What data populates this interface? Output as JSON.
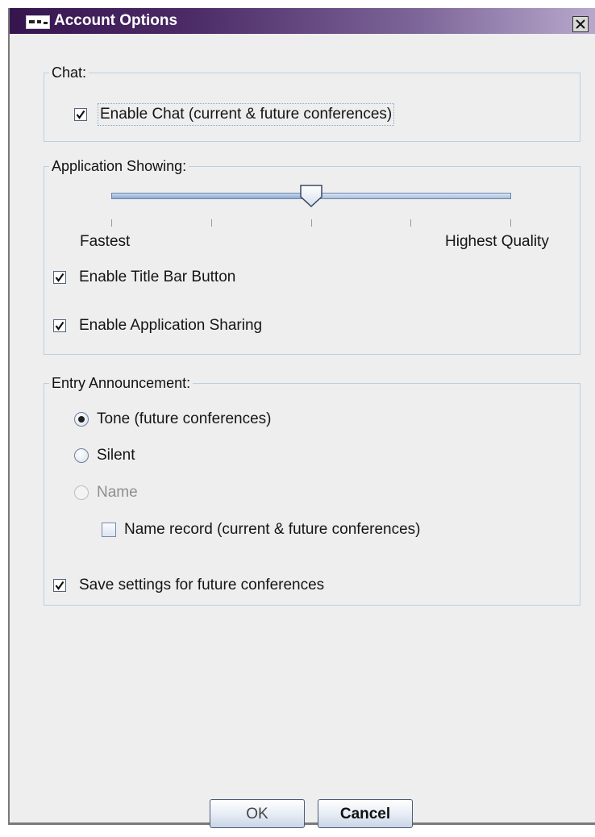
{
  "window": {
    "title": "Account Options"
  },
  "chat": {
    "group_label": "Chat:",
    "enable_chat": {
      "label": "Enable Chat (current & future conferences)",
      "checked": true
    }
  },
  "app_showing": {
    "group_label": "Application Showing:",
    "slider": {
      "min_label": "Fastest",
      "max_label": "Highest Quality",
      "value": 0.5,
      "ticks": 5
    },
    "title_bar_button": {
      "label": "Enable Title Bar Button",
      "checked": true
    },
    "app_sharing": {
      "label": "Enable Application Sharing",
      "checked": true
    }
  },
  "entry": {
    "group_label": "Entry Announcement:",
    "tone": {
      "label": "Tone (future conferences)",
      "selected": true
    },
    "silent": {
      "label": "Silent",
      "selected": false
    },
    "name": {
      "label": "Name",
      "selected": false,
      "disabled": true
    },
    "name_record": {
      "label": "Name record (current & future conferences)",
      "checked": false
    },
    "save_settings": {
      "label": "Save settings for future conferences",
      "checked": true
    }
  },
  "buttons": {
    "ok": "OK",
    "cancel": "Cancel"
  },
  "colors": {
    "title_start": "#36154f",
    "title_end": "#b8a8cc",
    "group_border": "#b8cfe5",
    "slider": "#a9bfdd"
  }
}
